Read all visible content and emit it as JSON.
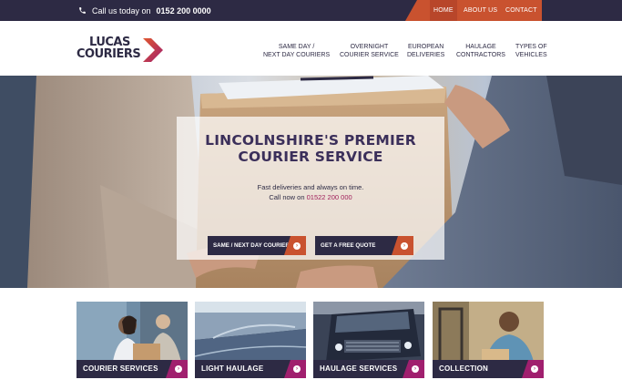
{
  "colors": {
    "navy": "#2d2a44",
    "orange": "#c9522f",
    "magenta": "#a01f6e",
    "phone_accent": "#a01f5a"
  },
  "topbar": {
    "phone_icon": "phone-icon",
    "phone_prefix": "Call us today on",
    "phone_number": "0152 200 0000",
    "nav": [
      {
        "label": "HOME",
        "active": true
      },
      {
        "label": "ABOUT US",
        "active": false
      },
      {
        "label": "CONTACT",
        "active": false
      }
    ]
  },
  "header": {
    "logo_line1": "LUCAS",
    "logo_line2": "COURIERS",
    "nav": [
      {
        "line1": "SAME DAY /",
        "line2": "NEXT DAY COURIERS"
      },
      {
        "line1": "OVERNIGHT",
        "line2": "COURIER SERVICE"
      },
      {
        "line1": "EUROPEAN",
        "line2": "DELIVERIES"
      },
      {
        "line1": "HAULAGE",
        "line2": "CONTRACTORS"
      },
      {
        "line1": "TYPES OF",
        "line2": "VEHICLES"
      }
    ]
  },
  "hero": {
    "title_line1": "LINCOLNSHIRE'S PREMIER",
    "title_line2": "COURIER SERVICE",
    "subtitle": "Fast deliveries and always on time.",
    "call_prefix": "Call now on",
    "call_number": "01522 200 000",
    "cta_primary": "SAME / NEXT DAY COURIER",
    "cta_secondary": "GET A FREE QUOTE",
    "arrow_icon": "chevron-right-icon"
  },
  "services": [
    {
      "label": "COURIER SERVICES"
    },
    {
      "label": "LIGHT HAULAGE"
    },
    {
      "label": "HAULAGE SERVICES"
    },
    {
      "label": "COLLECTION"
    }
  ]
}
